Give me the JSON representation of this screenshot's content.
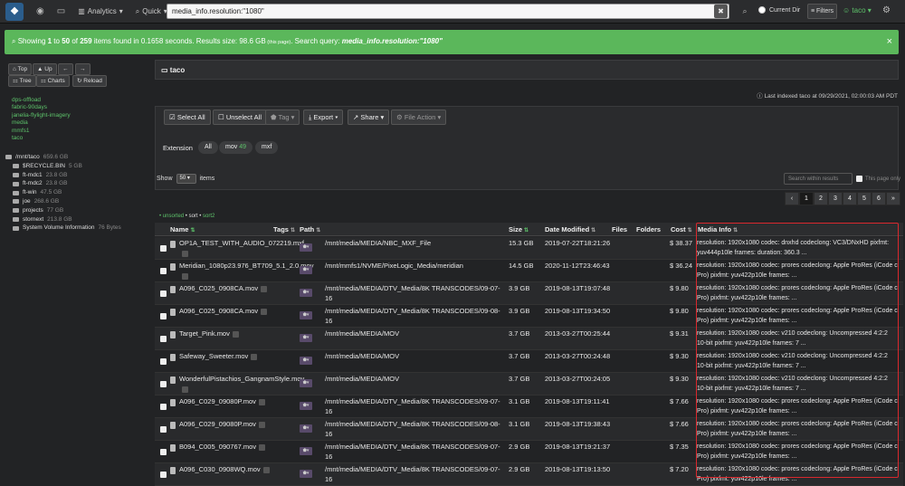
{
  "topbar": {
    "logo_text": "❖",
    "home_icon": "dashboard-icon",
    "analytics_label": "Analytics",
    "quick_label": "Quick",
    "search_value": "media_info.resolution:\"1080\"",
    "clear_label": "✖",
    "search_icon": "⌕",
    "current_dir_label": "Current Dir",
    "filters_label": "Filters",
    "user_label": "taco",
    "gear_icon": "⚙"
  },
  "banner": {
    "pre": "Showing ",
    "from": "1",
    "to_word": " to ",
    "to": "50",
    "of_word": " of ",
    "total": "259",
    "mid": " items found in ",
    "time": "0.1658",
    "post": " seconds. Results size: ",
    "size": "98.6 GB",
    "small": " (this page)",
    "query_label": ". Search query: ",
    "query": "media_info.resolution:\"1080\"",
    "close": "×"
  },
  "sidebar": {
    "top_label": "Top",
    "up_label": "Up",
    "back_label": "←",
    "fwd_label": "→",
    "tree_label": "Tree",
    "charts_label": "Charts",
    "reload_label": "Reload",
    "indexes": [
      "dps-offload",
      "fabric-90days",
      "janelia-flylight-imagery",
      "media",
      "mmfs1",
      "taco"
    ],
    "tree": [
      {
        "name": "/mnt/taco",
        "size": "659.6 GB",
        "indent": 0
      },
      {
        "name": "$RECYCLE.BIN",
        "size": "5 GB",
        "indent": 1
      },
      {
        "name": "ft-mdc1",
        "size": "23.8 GB",
        "indent": 1
      },
      {
        "name": "ft-mdc2",
        "size": "23.8 GB",
        "indent": 1
      },
      {
        "name": "ft-win",
        "size": "47.5 GB",
        "indent": 1
      },
      {
        "name": "joe",
        "size": "268.6 GB",
        "indent": 1
      },
      {
        "name": "projects",
        "size": "77 GB",
        "indent": 1
      },
      {
        "name": "stornext",
        "size": "213.8 GB",
        "indent": 1
      },
      {
        "name": "System Volume Information",
        "size": "76 Bytes",
        "indent": 1
      }
    ]
  },
  "main": {
    "panel_title": "taco",
    "last_indexed": "Last indexed taco at 09/29/2021, 02:00:03 AM PDT",
    "select_all": "Select All",
    "unselect_all": "Unselect All",
    "tag": "Tag",
    "export": "Export",
    "share": "Share",
    "file_action": "File Action",
    "extension_label": "Extension",
    "ext_all": "All",
    "ext_mov": "mov",
    "ext_mov_count": "49",
    "ext_mxf": "mxf",
    "show_label": "Show",
    "show_value": "50",
    "items_label": "items",
    "search_within_placeholder": "Search within results",
    "this_page_only": "This page only",
    "pages": [
      "‹",
      "1",
      "2",
      "3",
      "4",
      "5",
      "6",
      "»"
    ],
    "active_page": "1",
    "sort_text": "unsorted",
    "sort_sep1": " • sort • ",
    "sort2": "sort2"
  },
  "table": {
    "headers": {
      "name": "Name",
      "tags": "Tags",
      "path": "Path",
      "size": "Size",
      "date": "Date Modified",
      "files": "Files",
      "folders": "Folders",
      "cost": "Cost",
      "media": "Media Info"
    },
    "rows": [
      {
        "name": "OP1A_TEST_WITH_AUDIO_072219.mxf",
        "path": "/mnt/media/MEDIA/NBC_MXF_File",
        "size": "15.3 GB",
        "date": "2019-07-22T18:21:26",
        "cost": "$ 38.37",
        "media": "resolution: 1920x1080 codec: dnxhd codeclong: VC3/DNxHD pixfmt: yuv444p10le frames: duration: 360.3 ..."
      },
      {
        "name": "Meridian_1080p23.976_BT709_5.1_2.0.mov",
        "path": "/mnt/mmfs1/NVME/PixeLogic_Media/meridian",
        "size": "14.5 GB",
        "date": "2020-11-12T23:46:43",
        "cost": "$ 36.24",
        "media": "resolution: 1920x1080 codec: prores codeclong: Apple ProRes (iCode c Pro) pixfmt: yuv422p10le frames: ..."
      },
      {
        "name": "A096_C025_0908CA.mov",
        "path": "/mnt/media/MEDIA/DTV_Media/8K TRANSCODES/09-07-16",
        "size": "3.9 GB",
        "date": "2019-08-13T19:07:48",
        "cost": "$ 9.80",
        "media": "resolution: 1920x1080 codec: prores codeclong: Apple ProRes (iCode c Pro) pixfmt: yuv422p10le frames: ..."
      },
      {
        "name": "A096_C025_0908CA.mov",
        "path": "/mnt/media/MEDIA/DTV_Media/8K TRANSCODES/09-08-16",
        "size": "3.9 GB",
        "date": "2019-08-13T19:34:50",
        "cost": "$ 9.80",
        "media": "resolution: 1920x1080 codec: prores codeclong: Apple ProRes (iCode c Pro) pixfmt: yuv422p10le frames: ..."
      },
      {
        "name": "Target_Pink.mov",
        "path": "/mnt/media/MEDIA/MOV",
        "size": "3.7 GB",
        "date": "2013-03-27T00:25:44",
        "cost": "$ 9.31",
        "media": "resolution: 1920x1080 codec: v210 codeclong: Uncompressed 4:2:2 10-bit pixfmt: yuv422p10le frames: 7 ..."
      },
      {
        "name": "Safeway_Sweeter.mov",
        "path": "/mnt/media/MEDIA/MOV",
        "size": "3.7 GB",
        "date": "2013-03-27T00:24:48",
        "cost": "$ 9.30",
        "media": "resolution: 1920x1080 codec: v210 codeclong: Uncompressed 4:2:2 10-bit pixfmt: yuv422p10le frames: 7 ..."
      },
      {
        "name": "WonderfulPistachios_GangnamStyle.mov",
        "path": "/mnt/media/MEDIA/MOV",
        "size": "3.7 GB",
        "date": "2013-03-27T00:24:05",
        "cost": "$ 9.30",
        "media": "resolution: 1920x1080 codec: v210 codeclong: Uncompressed 4:2:2 10-bit pixfmt: yuv422p10le frames: 7 ..."
      },
      {
        "name": "A096_C029_09080P.mov",
        "path": "/mnt/media/MEDIA/DTV_Media/8K TRANSCODES/09-07-16",
        "size": "3.1 GB",
        "date": "2019-08-13T19:11:41",
        "cost": "$ 7.66",
        "media": "resolution: 1920x1080 codec: prores codeclong: Apple ProRes (iCode c Pro) pixfmt: yuv422p10le frames: ..."
      },
      {
        "name": "A096_C029_09080P.mov",
        "path": "/mnt/media/MEDIA/DTV_Media/8K TRANSCODES/09-08-16",
        "size": "3.1 GB",
        "date": "2019-08-13T19:38:43",
        "cost": "$ 7.66",
        "media": "resolution: 1920x1080 codec: prores codeclong: Apple ProRes (iCode c Pro) pixfmt: yuv422p10le frames: ..."
      },
      {
        "name": "B094_C005_090767.mov",
        "path": "/mnt/media/MEDIA/DTV_Media/8K TRANSCODES/09-07-16",
        "size": "2.9 GB",
        "date": "2019-08-13T19:21:37",
        "cost": "$ 7.35",
        "media": "resolution: 1920x1080 codec: prores codeclong: Apple ProRes (iCode c Pro) pixfmt: yuv422p10le frames: ..."
      },
      {
        "name": "A096_C030_0908WQ.mov",
        "path": "/mnt/media/MEDIA/DTV_Media/8K TRANSCODES/09-07-16",
        "size": "2.9 GB",
        "date": "2019-08-13T19:13:50",
        "cost": "$ 7.20",
        "media": "resolution: 1920x1080 codec: prores codeclong: Apple ProRes (iCode c Pro) pixfmt: yuv422p10le frames: ..."
      }
    ]
  }
}
